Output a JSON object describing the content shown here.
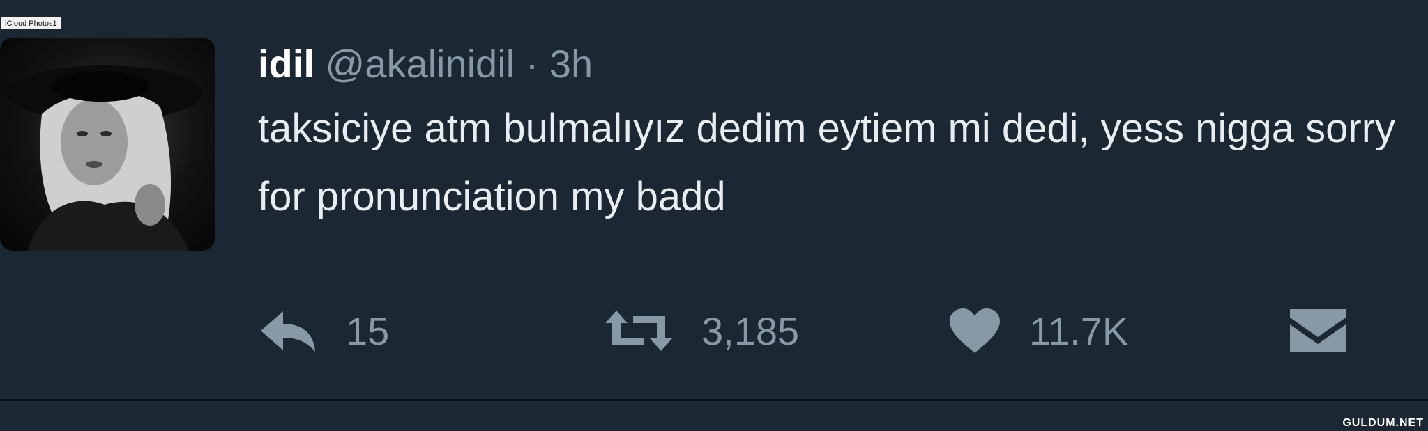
{
  "window": {
    "label": "iCloud Photos1"
  },
  "tweet": {
    "display_name": "idil",
    "handle": "@akalinidil",
    "separator": "·",
    "time": "3h",
    "text": "taksiciye atm bulmalıyız dedim eytiem mi dedi, yess nigga sorry for pronunciation my badd"
  },
  "actions": {
    "reply": {
      "icon": "reply-icon",
      "count": "15"
    },
    "retweet": {
      "icon": "retweet-icon",
      "count": "3,185"
    },
    "like": {
      "icon": "heart-icon",
      "count": "11.7K"
    },
    "message": {
      "icon": "envelope-icon"
    }
  },
  "watermark": {
    "text": "GULDUM.NET"
  },
  "colors": {
    "background": "#1b2733",
    "text": "#e8edf1",
    "muted": "#8899a6"
  }
}
